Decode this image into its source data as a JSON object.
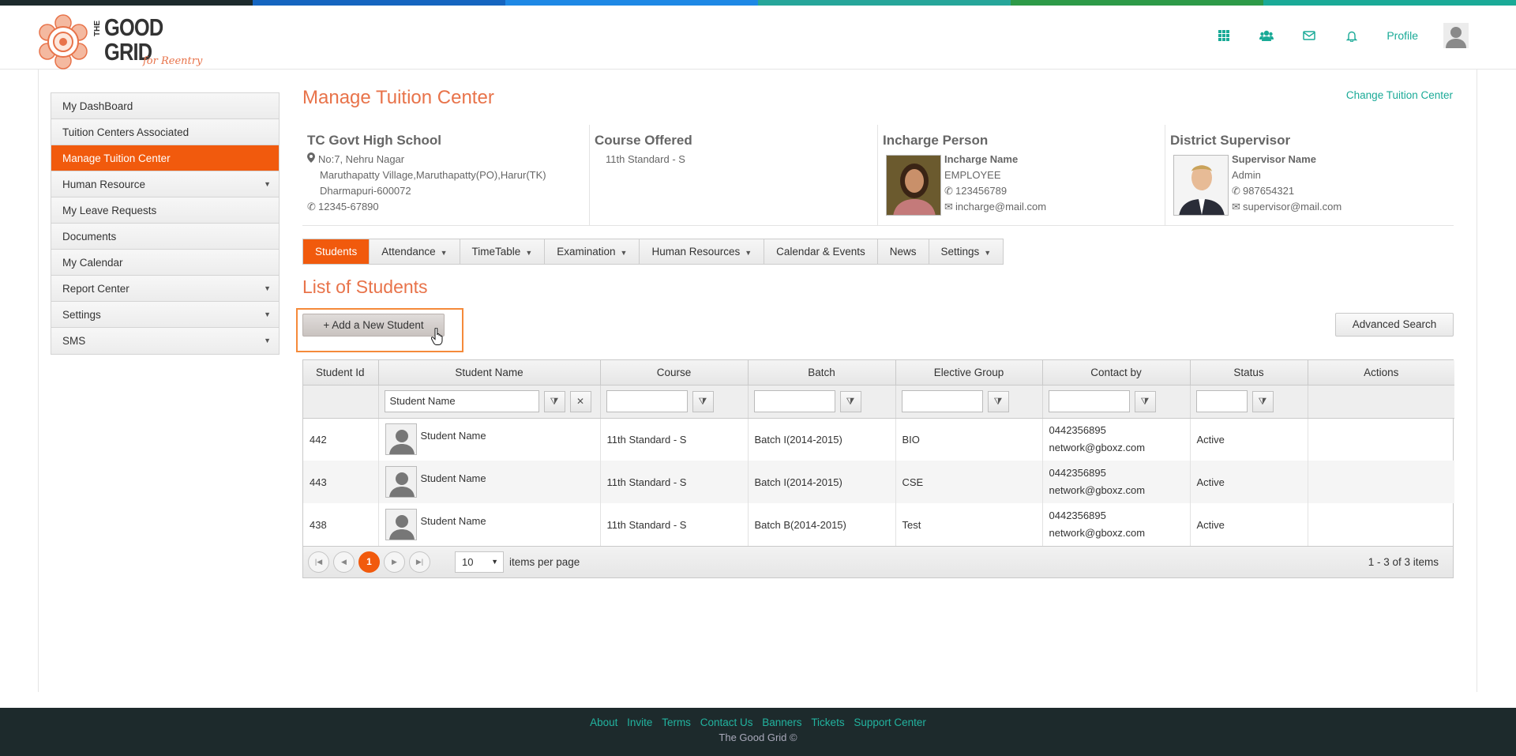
{
  "colors": {
    "accent": "#f15a0d",
    "title": "#e8734a",
    "link": "#1aaa97",
    "footer_bg": "#1d2a2c",
    "stripe": [
      "#1d2a2c",
      "#1565c0",
      "#1e88e5",
      "#26a69a",
      "#2e9a48",
      "#1aaa97"
    ]
  },
  "header": {
    "logo": {
      "title_line1": "GOOD",
      "title_line2": "GRID",
      "small": "THE",
      "sub": "for Reentry"
    },
    "icons": [
      "apps-icon",
      "users-icon",
      "mail-icon",
      "bell-icon"
    ],
    "profile_label": "Profile"
  },
  "sidebar": {
    "items": [
      {
        "label": "My DashBoard",
        "caret": false,
        "active": false
      },
      {
        "label": "Tuition Centers Associated",
        "caret": false,
        "active": false
      },
      {
        "label": "Manage Tuition Center",
        "caret": false,
        "active": true
      },
      {
        "label": "Human Resource",
        "caret": true,
        "active": false
      },
      {
        "label": "My Leave Requests",
        "caret": false,
        "active": false
      },
      {
        "label": "Documents",
        "caret": false,
        "active": false
      },
      {
        "label": "My Calendar",
        "caret": false,
        "active": false
      },
      {
        "label": "Report Center",
        "caret": true,
        "active": false
      },
      {
        "label": "Settings",
        "caret": true,
        "active": false
      },
      {
        "label": "SMS",
        "caret": true,
        "active": false
      }
    ]
  },
  "main": {
    "title": "Manage Tuition Center",
    "change_link": "Change Tuition Center",
    "center": {
      "name": "TC Govt High School",
      "address_line1": "No:7, Nehru Nagar",
      "address_line2": "Maruthapatty Village,Maruthapatty(PO),Harur(TK)",
      "address_line3": "Dharmapuri-600072",
      "phone": "12345-67890"
    },
    "course": {
      "heading": "Course Offered",
      "value": "11th Standard - S"
    },
    "incharge": {
      "heading": "Incharge Person",
      "name": "Incharge Name",
      "role": "EMPLOYEE",
      "phone": "123456789",
      "email": "incharge@mail.com"
    },
    "supervisor": {
      "heading": "District Supervisor",
      "name": "Supervisor Name",
      "role": "Admin",
      "phone": "987654321",
      "email": "supervisor@mail.com"
    },
    "tabs": [
      {
        "label": "Students",
        "caret": false,
        "active": true
      },
      {
        "label": "Attendance",
        "caret": true,
        "active": false
      },
      {
        "label": "TimeTable",
        "caret": true,
        "active": false
      },
      {
        "label": "Examination",
        "caret": true,
        "active": false
      },
      {
        "label": "Human Resources",
        "caret": true,
        "active": false
      },
      {
        "label": "Calendar & Events",
        "caret": false,
        "active": false
      },
      {
        "label": "News",
        "caret": false,
        "active": false
      },
      {
        "label": "Settings",
        "caret": true,
        "active": false
      }
    ],
    "list_title": "List of Students",
    "add_button": "+ Add a New Student",
    "advanced_search": "Advanced Search"
  },
  "grid": {
    "columns": [
      "Student Id",
      "Student Name",
      "Course",
      "Batch",
      "Elective Group",
      "Contact  by",
      "Status",
      "Actions"
    ],
    "filter_name_value": "Student Name",
    "rows": [
      {
        "id": "442",
        "name": "Student Name",
        "course": "11th Standard - S",
        "batch": "Batch I(2014-2015)",
        "elective": "BIO",
        "phone": "0442356895",
        "email": "network@gboxz.com",
        "status": "Active"
      },
      {
        "id": "443",
        "name": "Student Name",
        "course": "11th Standard - S",
        "batch": "Batch I(2014-2015)",
        "elective": "CSE",
        "phone": "0442356895",
        "email": "network@gboxz.com",
        "status": "Active"
      },
      {
        "id": "438",
        "name": "Student Name",
        "course": "11th Standard - S",
        "batch": "Batch B(2014-2015)",
        "elective": "Test",
        "phone": "0442356895",
        "email": "network@gboxz.com",
        "status": "Active"
      }
    ],
    "pager": {
      "current_page": "1",
      "per_page": "10",
      "per_page_label": "items per page",
      "range": "1 - 3 of 3 items"
    }
  },
  "footer": {
    "links": [
      "About",
      "Invite",
      "Terms",
      "Contact Us",
      "Banners",
      "Tickets",
      "Support Center"
    ],
    "copyright": "The Good Grid ©"
  }
}
